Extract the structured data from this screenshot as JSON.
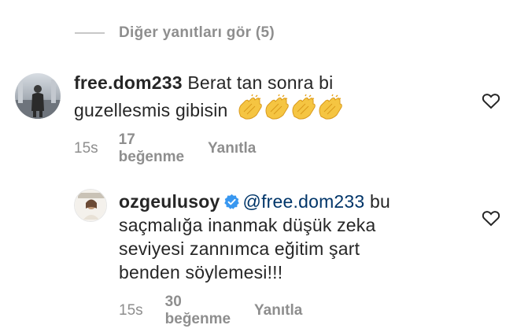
{
  "view_replies": {
    "label": "Diğer yanıtları gör (5)"
  },
  "comments": [
    {
      "username": "free.dom233",
      "text_line1": "Berat tan sonra bi",
      "text_line2": "guzellesmis gibisin",
      "emoji_icons": [
        "clapping-hands-icon",
        "clapping-hands-icon",
        "clapping-hands-icon",
        "clapping-hands-icon"
      ],
      "time": "15s",
      "likes": "17 beğenme",
      "reply_label": "Yanıtla"
    },
    {
      "username": "ozgeulusoy",
      "verified": true,
      "mention": "@free.dom233",
      "text_line1": "bu",
      "text_line2": "saçmalığa inanmak düşük zeka",
      "text_line3": "seviyesi zannımca eğitim şart",
      "text_line4": "benden söylemesi!!!",
      "time": "15s",
      "likes": "30 beğenme",
      "reply_label": "Yanıtla"
    }
  ],
  "colors": {
    "text": "#262626",
    "secondary": "#8e8e8e",
    "mention": "#003569",
    "verified": "#3897f0",
    "emoji": "#f5c542"
  }
}
